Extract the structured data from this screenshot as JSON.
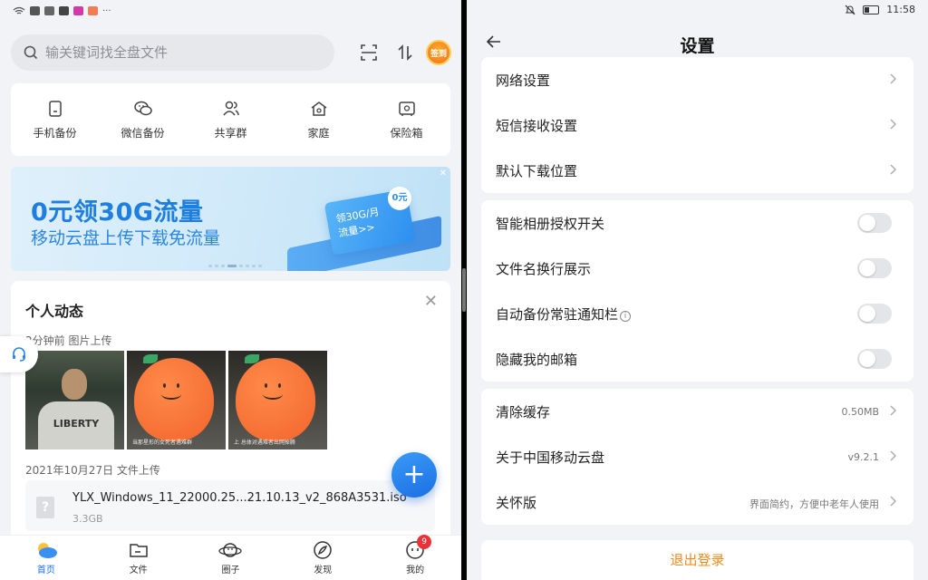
{
  "left": {
    "search": {
      "placeholder": "输关键词找全盘文件"
    },
    "signin_label": "签到",
    "quick_actions": [
      {
        "label": "手机备份",
        "icon": "phone-backup-icon"
      },
      {
        "label": "微信备份",
        "icon": "wechat-icon"
      },
      {
        "label": "共享群",
        "icon": "group-icon"
      },
      {
        "label": "家庭",
        "icon": "home-icon"
      },
      {
        "label": "保险箱",
        "icon": "safe-icon"
      }
    ],
    "banner": {
      "title": "0元领30G流量",
      "subtitle": "移动云盘上传下载免流量",
      "card_text": "领30G/月",
      "card_link": "流量>>",
      "card_badge": "0元"
    },
    "activity": {
      "title": "个人动态",
      "entry1_meta": "2分钟前  图片上传",
      "thumb_shirt_text": "LIBERTY",
      "thumb_caption_1": "当那星形的女死者遇难群",
      "thumb_caption_2": "上 总体对遇难者出网掉腾",
      "entry2_meta": "2021年10月27日  文件上传",
      "file": {
        "name": "YLX_Windows_11_22000.25...21.10.13_v2_868A3531.iso",
        "size": "3.3GB",
        "icon_glyph": "?"
      }
    },
    "fab_label": "+",
    "tabs": [
      {
        "label": "首页",
        "icon": "home-tab-icon",
        "active": true
      },
      {
        "label": "文件",
        "icon": "folder-icon",
        "active": false
      },
      {
        "label": "圈子",
        "icon": "planet-icon",
        "active": false
      },
      {
        "label": "发现",
        "icon": "compass-icon",
        "active": false
      },
      {
        "label": "我的",
        "icon": "profile-icon",
        "active": false,
        "badge": "9"
      }
    ]
  },
  "right": {
    "status": {
      "time": "11:58",
      "battery_level": 0.35
    },
    "title": "设置",
    "group1": [
      {
        "label": "网络设置"
      },
      {
        "label": "短信接收设置"
      },
      {
        "label": "默认下载位置"
      }
    ],
    "group2": [
      {
        "label": "智能相册授权开关",
        "on": false
      },
      {
        "label": "文件名换行展示",
        "on": false
      },
      {
        "label": "自动备份常驻通知栏",
        "on": false,
        "info": "i"
      },
      {
        "label": "隐藏我的邮箱",
        "on": false
      }
    ],
    "group3": [
      {
        "label": "清除缓存",
        "value": "0.50MB"
      },
      {
        "label": "关于中国移动云盘",
        "value": "v9.2.1"
      },
      {
        "label": "关怀版",
        "value": "界面简约，方便中老年人使用"
      }
    ],
    "logout_label": "退出登录"
  },
  "colors": {
    "accent": "#1c6fe2",
    "logout": "#ef8a1e",
    "badge": "#e8323a"
  }
}
